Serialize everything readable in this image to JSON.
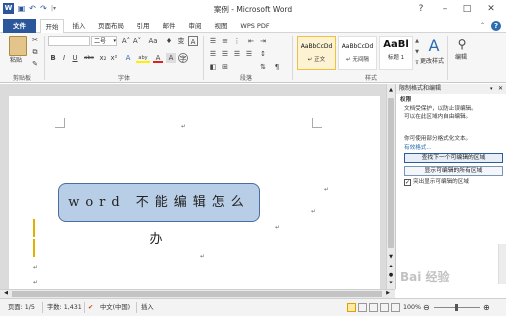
{
  "window": {
    "title": "案例 - Microsoft Word",
    "controls": {
      "help": "?",
      "minimize": "–",
      "restore": "□",
      "close": "✕"
    }
  },
  "quick_access": {
    "icons": [
      "word-logo-icon",
      "save-icon",
      "undo-icon",
      "redo-icon",
      "customize-icon"
    ]
  },
  "tabs": [
    "文件",
    "开始",
    "插入",
    "页面布局",
    "引用",
    "邮件",
    "审阅",
    "视图",
    "WPS PDF"
  ],
  "ribbon": {
    "clipboard": {
      "paste_label": "粘贴",
      "group_label": "剪贴板"
    },
    "font": {
      "font_name": "",
      "size": "二号",
      "grow": "A˄",
      "shrink": "A˅",
      "case": "Aa",
      "clear": "♦",
      "phonetic": "变",
      "border": "A",
      "bold": "B",
      "italic": "I",
      "underline": "U",
      "strike": "abc",
      "sub": "x₂",
      "sup": "x²",
      "effects": "A",
      "highlight": "aby",
      "color": "A",
      "shade": "A",
      "circle": "字",
      "group_label": "字体"
    },
    "paragraph": {
      "group_label": "段落"
    },
    "styles": {
      "items": [
        {
          "sample": "AaBbCcDd",
          "name": "↵ 正文"
        },
        {
          "sample": "AaBbCcDd",
          "name": "↵ 无间隔"
        },
        {
          "sample": "AaBl",
          "name": "标题 1"
        }
      ],
      "change_label": "更改样式",
      "group_label": "样式"
    },
    "editing": {
      "label": "编辑"
    }
  },
  "document": {
    "callout_text": "word 不能编辑怎么办",
    "paragraph_mark": "↵"
  },
  "pane": {
    "title": "限制格式和编辑",
    "section": "权限",
    "protected_note": "文档受保护，以防止误编辑。",
    "editable_note": "可以在此区域内自由编辑。",
    "multi_format": "你可使用部分格式化文本。",
    "valid_format": "有效格式...",
    "find_next": "查找下一个可编辑的区域",
    "show_all": "显示可编辑的所有区域",
    "highlight_label": "突出显示可编辑的区域",
    "highlight_checked": true
  },
  "status": {
    "page": "页面: 1/5",
    "words": "字数: 1,431",
    "lang": "中文(中国)",
    "mode": "插入",
    "zoom": "100%"
  },
  "watermark": "Bai 经验"
}
